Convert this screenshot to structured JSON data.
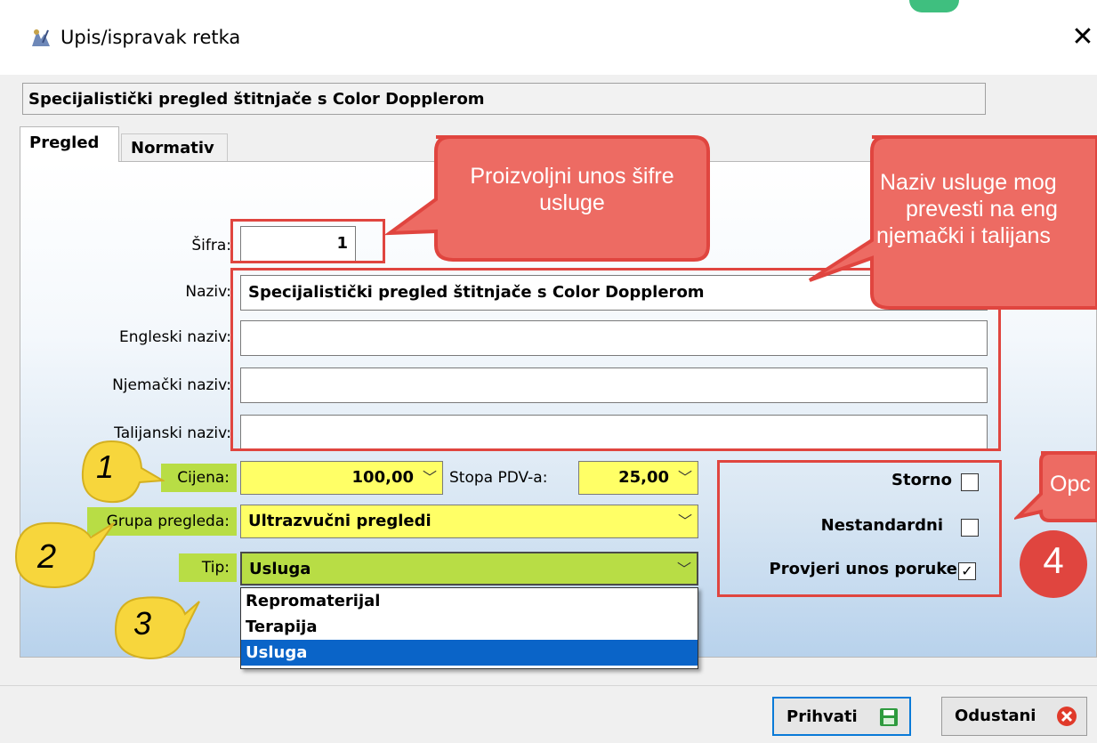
{
  "window": {
    "title": "Upis/ispravak retka",
    "close_glyph": "✕"
  },
  "header": {
    "value": "Specijalistički pregled štitnjače s Color Dopplerom"
  },
  "tabs": [
    {
      "label": "Pregled",
      "active": true
    },
    {
      "label": "Normativ",
      "active": false
    }
  ],
  "form": {
    "sifra": {
      "label": "Šifra:",
      "value": "1"
    },
    "naziv": {
      "label": "Naziv:",
      "value": "Specijalistički pregled štitnjače s Color Dopplerom"
    },
    "engleski": {
      "label": "Engleski naziv:",
      "value": ""
    },
    "njemacki": {
      "label": "Njemački naziv:",
      "value": ""
    },
    "talijanski": {
      "label": "Talijanski naziv:",
      "value": ""
    },
    "cijena": {
      "label": "Cijena:",
      "value": "100,00"
    },
    "stopa_pdv": {
      "label": "Stopa PDV-a:",
      "value": "25,00"
    },
    "grupa": {
      "label": "Grupa pregleda:",
      "value": "Ultrazvučni pregledi"
    },
    "tip": {
      "label": "Tip:",
      "value": "Usluga",
      "options": [
        "Repromaterijal",
        "Terapija",
        "Usluga"
      ]
    }
  },
  "options": {
    "storno": {
      "label": "Storno",
      "checked": false
    },
    "nestandardni": {
      "label": "Nestandardni",
      "checked": false
    },
    "provjeri": {
      "label": "Provjeri unos poruke",
      "checked": true,
      "check_glyph": "✓"
    }
  },
  "callouts": {
    "sifra": "Proizvoljni unos šifre usluge",
    "naziv_line1": "Naziv usluge mog",
    "naziv_line2": "prevesti na eng",
    "naziv_line3": "njemački i talijans",
    "opc": "Opc"
  },
  "markers": {
    "m1": "1",
    "m2": "2",
    "m3": "3",
    "m4": "4"
  },
  "buttons": {
    "accept": "Prihvati",
    "cancel": "Odustani"
  },
  "colors": {
    "highlight": "#b8dd45",
    "input_yellow": "#ffff66",
    "annotation_red": "#e0453f",
    "selection_blue": "#0a64c8"
  }
}
